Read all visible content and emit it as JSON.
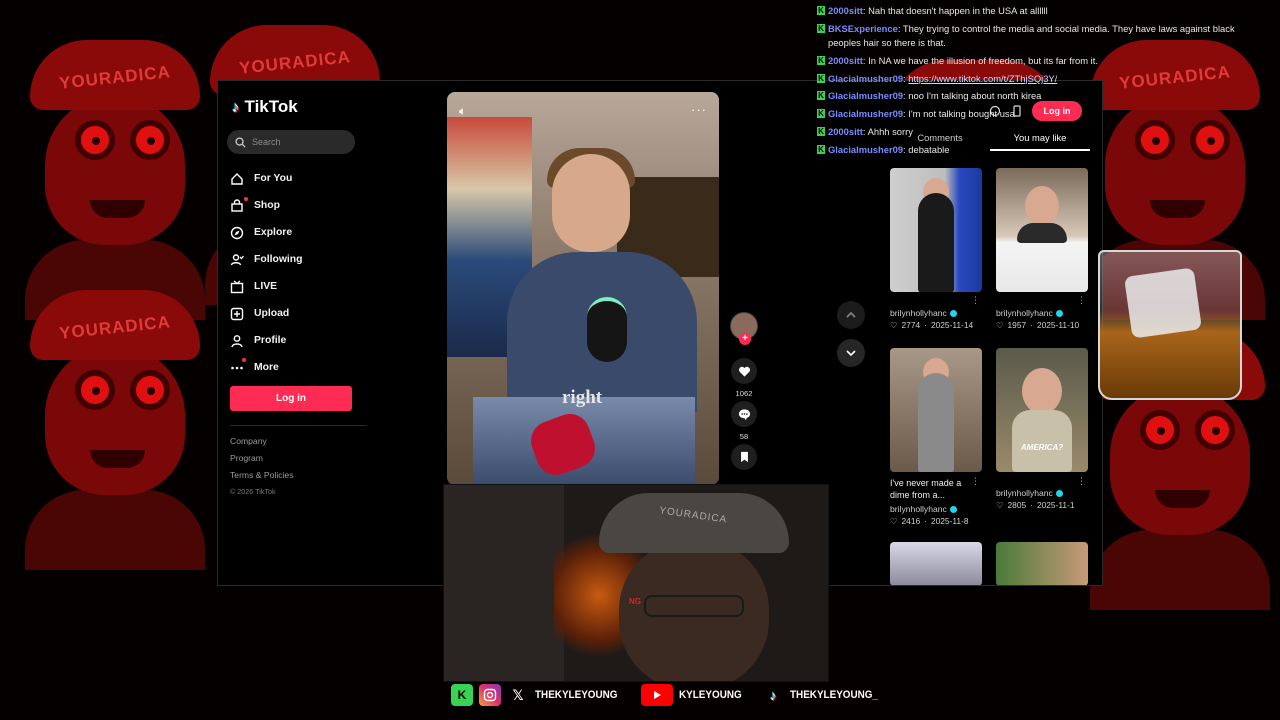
{
  "chat": [
    {
      "user": "2000sitt",
      "text": "Nah that doesn't happen in the USA at allllll"
    },
    {
      "user": "BKSExperience",
      "text": "They trying to control the media and social media. They have laws against black peoples hair so there is that."
    },
    {
      "user": "2000sitt",
      "text": "In NA we have the illusion of freedom, but its far from it."
    },
    {
      "user": "Glacialmusher09",
      "text": "https://www.tiktok.com/t/ZThjSQj3Y/"
    },
    {
      "user": "Glacialmusher09",
      "text": "noo I'm talking about north kirea"
    },
    {
      "user": "Glacialmusher09",
      "text": "I'm not talking bought usa"
    },
    {
      "user": "2000sitt",
      "text": "Ahhh sorry"
    },
    {
      "user": "Glacialmusher09",
      "text": "debatable"
    }
  ],
  "overlay": {
    "cap_text": "YOURADICA",
    "webcam_hat": "YOURADICA",
    "webcam_tag": "NG"
  },
  "tiktok": {
    "brand": "TikTok",
    "search_placeholder": "Search",
    "nav": [
      {
        "label": "For You",
        "icon": "home-icon"
      },
      {
        "label": "Shop",
        "icon": "shop-icon"
      },
      {
        "label": "Explore",
        "icon": "compass-icon"
      },
      {
        "label": "Following",
        "icon": "following-icon"
      },
      {
        "label": "LIVE",
        "icon": "live-icon"
      },
      {
        "label": "Upload",
        "icon": "upload-icon"
      },
      {
        "label": "Profile",
        "icon": "profile-icon"
      },
      {
        "label": "More",
        "icon": "more-icon"
      }
    ],
    "login_label": "Log in",
    "footer": {
      "company": "Company",
      "program": "Program",
      "terms": "Terms & Policies",
      "copyright": "© 2026 TikTok"
    },
    "video": {
      "caption": "right"
    },
    "actions": {
      "likes": "1062",
      "comments": "58"
    },
    "right_panel": {
      "login_label": "Log in",
      "tabs": [
        "Comments",
        "You may like"
      ],
      "active_tab": "You may like",
      "cards": [
        {
          "title": "",
          "user": "brilynhollyhanc",
          "likes": "2774",
          "date": "2025-11-14"
        },
        {
          "title": "",
          "user": "brilynhollyhanc",
          "likes": "1957",
          "date": "2025-11-10"
        },
        {
          "title": "I've never made a dime from a...",
          "user": "brilynhollyhanc",
          "likes": "2416",
          "date": "2025-11-8"
        },
        {
          "title": "",
          "user": "brilynhollyhanc",
          "likes": "2805",
          "date": "2025-11-1",
          "overlay": "AMERICA?"
        }
      ]
    }
  },
  "socials": [
    {
      "platform": "kick",
      "label": ""
    },
    {
      "platform": "instagram",
      "label": ""
    },
    {
      "platform": "x",
      "label": "THEKYLEYOUNG"
    },
    {
      "platform": "youtube",
      "label": "KYLEYOUNG"
    },
    {
      "platform": "tiktok",
      "label": "THEKYLEYOUNG_"
    }
  ],
  "colors": {
    "accent": "#fe2c55",
    "chat_user": "#7a8cff",
    "kick_green": "#39d353"
  }
}
